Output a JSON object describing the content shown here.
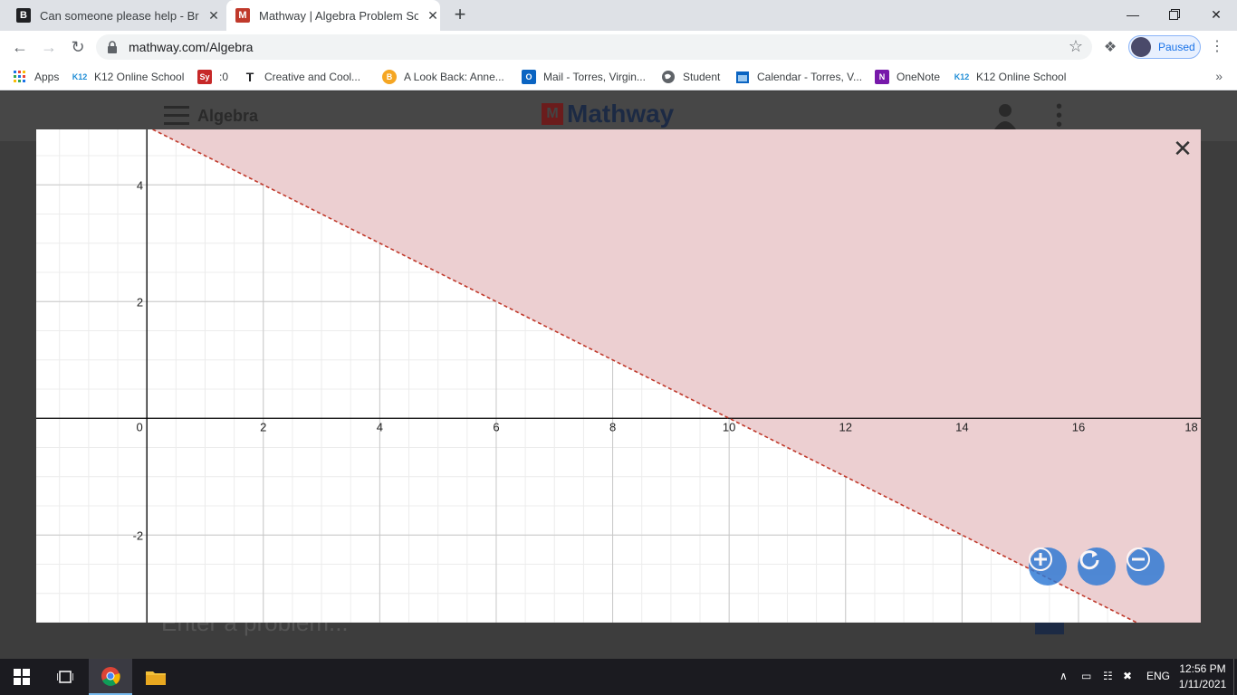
{
  "browser": {
    "tabs": [
      {
        "title": "Can someone please help - Brain",
        "favicon_letter": "B",
        "active": false
      },
      {
        "title": "Mathway | Algebra Problem Solv",
        "favicon_letter": "M",
        "active": true
      }
    ],
    "url": "mathway.com/Algebra",
    "profile_label": "Paused",
    "bookmarks": [
      {
        "label": "Apps",
        "icon": "apps-grid-icon"
      },
      {
        "label": "K12 Online School",
        "icon": "k12-icon",
        "badge": "K12"
      },
      {
        "label": ":0",
        "icon": "sy-icon",
        "badge": "Sy"
      },
      {
        "label": "Creative and Cool...",
        "icon": "t-icon",
        "badge": "T"
      },
      {
        "label": "A Look Back: Anne...",
        "icon": "b-coin-icon",
        "badge": "B"
      },
      {
        "label": "Mail - Torres, Virgin...",
        "icon": "outlook-icon",
        "badge": "O"
      },
      {
        "label": "Student",
        "icon": "globe-icon",
        "badge": ""
      },
      {
        "label": "Calendar - Torres, V...",
        "icon": "calendar-icon",
        "badge": ""
      },
      {
        "label": "OneNote",
        "icon": "onenote-icon",
        "badge": "N"
      },
      {
        "label": "K12 Online School",
        "icon": "k12-icon",
        "badge": "K12"
      }
    ]
  },
  "page": {
    "app_title": "Algebra",
    "logo_text": "Mathway",
    "logo_letter": "M",
    "input_placeholder": "Enter a problem..."
  },
  "graph": {
    "close_symbol": "✕",
    "x_ticks": [
      "0",
      "2",
      "4",
      "6",
      "8",
      "10",
      "12",
      "14",
      "16",
      "18"
    ],
    "y_ticks": [
      "4",
      "2",
      "-2"
    ],
    "colors": {
      "shade": "#eccfd1",
      "boundary": "#c0392b",
      "grid_minor": "#ececec",
      "grid_major": "#c8c8c8",
      "axis": "#000000"
    }
  },
  "chart_data": {
    "type": "line",
    "title": "",
    "xlabel": "",
    "ylabel": "",
    "xlim": [
      -1.9,
      18.1
    ],
    "ylim": [
      -3.5,
      4.95
    ],
    "grid": true,
    "series": [
      {
        "x": [
          0,
          10,
          17.5
        ],
        "y": [
          5,
          0,
          -3.75
        ],
        "style": "dashed",
        "color": "#c0392b"
      }
    ],
    "shaded_region": "above boundary line y = -0.5x + 5",
    "x_ticks": [
      0,
      2,
      4,
      6,
      8,
      10,
      12,
      14,
      16,
      18
    ],
    "y_ticks": [
      4,
      2,
      -2
    ]
  },
  "taskbar": {
    "time": "12:56 PM",
    "date": "1/11/2021",
    "language": "ENG"
  }
}
